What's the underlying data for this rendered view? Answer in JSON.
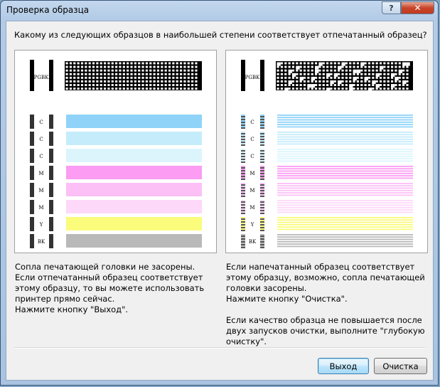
{
  "window": {
    "title": "Проверка образца"
  },
  "question": "Какому из следующих образцов в наибольшей степени соответствует отпечатанный образец?",
  "rows": [
    {
      "label": "C",
      "color": "#8fd3f8"
    },
    {
      "label": "C",
      "color": "#c5ecfb"
    },
    {
      "label": "C",
      "color": "#dcf5fd"
    },
    {
      "label": "M",
      "color": "#fc9cf3"
    },
    {
      "label": "M",
      "color": "#fcc0f7"
    },
    {
      "label": "M",
      "color": "#fdd8f9"
    },
    {
      "label": "Y",
      "color": "#fbfb7c"
    },
    {
      "label": "BK",
      "color": "#b9b9b9"
    }
  ],
  "pgbk_label": "PGBK",
  "left_description": "Сопла печатающей головки не засорены.\nЕсли отпечатанный образец соответствует этому образцу, то вы можете использовать принтер прямо сейчас.\nНажмите кнопку \"Выход\".",
  "right_description": "Если напечатанный образец соответствует этому образцу, возможно, сопла печатающей головки засорены.\nНажмите кнопку \"Очистка\".\n\nЕсли качество образца не повышается после двух запусков очистки, выполните \"глубокую очистку\".",
  "buttons": {
    "exit": "Выход",
    "clean": "Очистка"
  }
}
